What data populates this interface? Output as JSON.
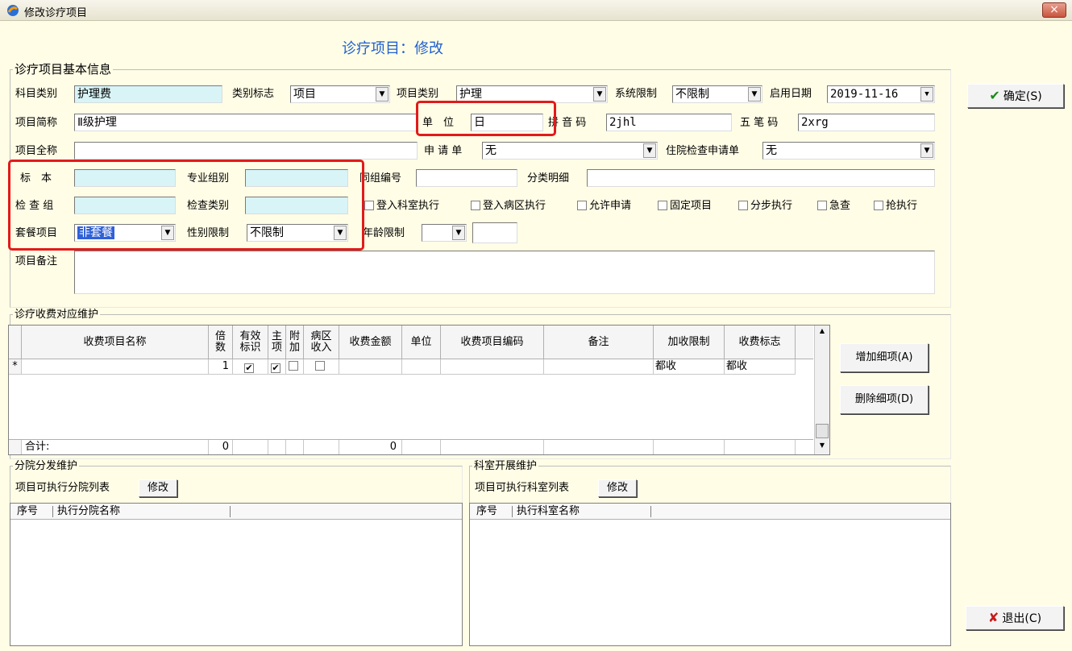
{
  "window": {
    "title": "修改诊疗项目",
    "heading": "诊疗项目：修改",
    "close": "×"
  },
  "basic": {
    "legend": "诊疗项目基本信息",
    "subject_type_label": "科目类别",
    "subject_type_value": "护理费",
    "category_flag_label": "类别标志",
    "category_flag_value": "项目",
    "item_type_label": "项目类别",
    "item_type_value": "护理",
    "system_limit_label": "系统限制",
    "system_limit_value": "不限制",
    "start_date_label": "启用日期",
    "start_date_value": "2019-11-16",
    "short_name_label": "项目简称",
    "short_name_value": "Ⅱ级护理",
    "unit_label": "单　位",
    "unit_value": "日",
    "pinyin_label": "拼 音 码",
    "pinyin_value": "2jhl",
    "wubi_label": "五 笔 码",
    "wubi_value": "2xrg",
    "full_name_label": "项目全称",
    "full_name_value": "",
    "request_form_label": "申 请 单",
    "request_form_value": "无",
    "inpatient_check_label": "住院检查申请单",
    "inpatient_check_value": "无",
    "specimen_label": "标　本",
    "specimen_value": "",
    "specialty_group_label": "专业组别",
    "specialty_group_value": "",
    "same_group_label": "同组编号",
    "same_group_value": "",
    "classify_detail_label": "分类明细",
    "classify_detail_value": "",
    "check_group_label": "检 查 组",
    "check_group_value": "",
    "check_type_label": "检查类别",
    "check_type_value": "",
    "checkboxes": [
      "登入科室执行",
      "登入病区执行",
      "允许申请",
      "固定项目",
      "分步执行",
      "急查",
      "抢执行"
    ],
    "package_label": "套餐项目",
    "package_value": "非套餐",
    "gender_limit_label": "性别限制",
    "gender_limit_value": "不限制",
    "age_limit_label": "年龄限制",
    "age_limit_value": "",
    "remark_label": "项目备注",
    "remark_value": ""
  },
  "fee": {
    "legend": "诊疗收费对应维护",
    "columns": [
      "收费项目名称",
      "倍数",
      "有效标识",
      "主项",
      "附加",
      "病区收入",
      "收费金额",
      "单位",
      "收费项目编码",
      "备注",
      "加收限制",
      "收费标志"
    ],
    "row": {
      "marker": "*",
      "multiple": "1",
      "extra_limit": "都收",
      "fee_flag": "都收"
    },
    "total_label": "合计:",
    "total_multiple": "0",
    "total_amount": "0",
    "add_button": "增加细项(A)",
    "delete_button": "删除细项(D)"
  },
  "branch": {
    "legend": "分院分发维护",
    "list_label": "项目可执行分院列表",
    "modify_button": "修改",
    "col1": "序号",
    "col2": "执行分院名称"
  },
  "dept": {
    "legend": "科室开展维护",
    "list_label": "项目可执行科室列表",
    "modify_button": "修改",
    "col1": "序号",
    "col2": "执行科室名称"
  },
  "actions": {
    "confirm": "确定(S)",
    "exit": "退出(C)"
  },
  "colors": {
    "accent_red": "#e21a1a",
    "heading_blue": "#2060d0",
    "field_cyan": "#d8f4f7"
  }
}
